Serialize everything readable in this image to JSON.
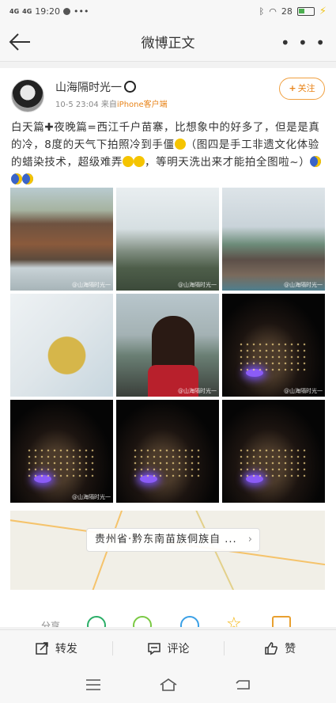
{
  "status_bar": {
    "signal1": "4G",
    "signal2": "4G",
    "time": "19:20",
    "more": "•••",
    "battery": "28"
  },
  "nav": {
    "title": "微博正文",
    "more": "• • •"
  },
  "post": {
    "author": "山海隔时光一",
    "time": "10-5 23:04",
    "from_prefix": "来自",
    "source": "iPhone客户端",
    "follow_label": "关注",
    "text_part1": "白天篇",
    "text_part2": "夜晚篇=西江千户苗寨，比想象中的好多了，但是是真的冷，8度的天气下拍照冷到手僵",
    "text_part3": "（图四是手工非遗文化体验的蜡染技术，超级难弄",
    "text_part4": "，等明天洗出来才能拍全图啦~）"
  },
  "photos": [
    {
      "watermark": "@山海隔时光一"
    },
    {
      "watermark": "@山海隔时光一"
    },
    {
      "watermark": "@山海隔时光一"
    },
    {
      "watermark": ""
    },
    {
      "watermark": "@山海隔时光一"
    },
    {
      "watermark": "@山海隔时光一"
    },
    {
      "watermark": "@山海隔时光一"
    },
    {
      "watermark": ""
    },
    {
      "watermark": ""
    }
  ],
  "location": {
    "label": "贵州省·黔东南苗族侗族自 ..."
  },
  "share": {
    "label": "分享"
  },
  "actions": {
    "repost": "转发",
    "comment": "评论",
    "like": "赞"
  }
}
